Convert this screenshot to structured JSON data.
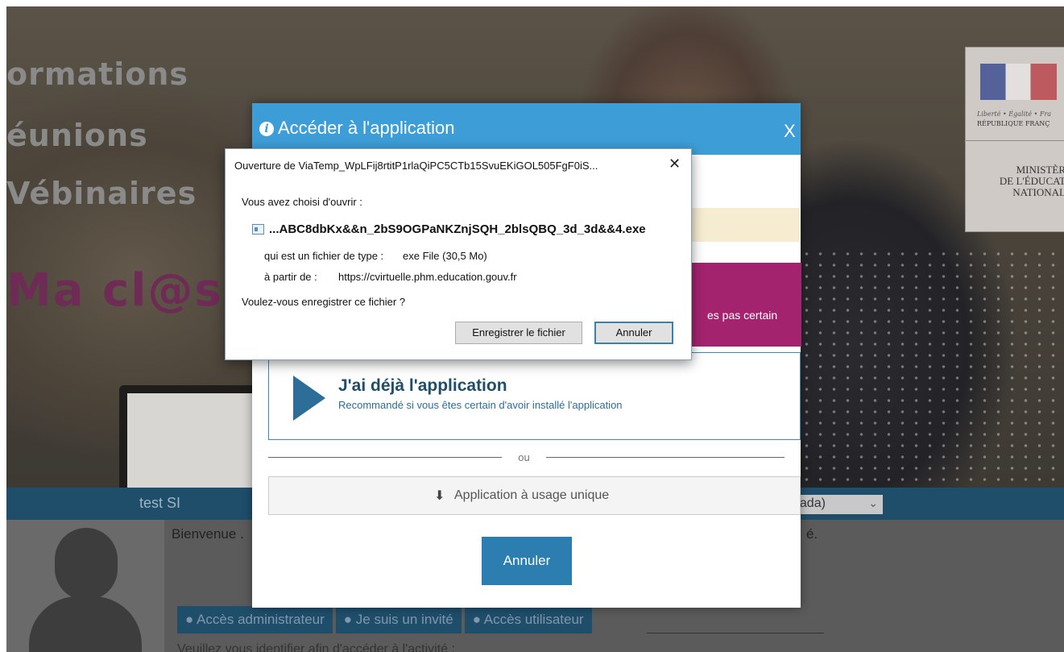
{
  "background": {
    "words": [
      "ormations",
      "éunions",
      "Vébinaires"
    ],
    "brand": "Ma cl@s",
    "logo": {
      "motto": "Liberté • Égalité • Fra",
      "republic": "RÉPUBLIQUE FRANÇ",
      "ministry": "MINISTÈR\nDE L'ÉDUCAT\nNATIONAL"
    },
    "bar": {
      "user": "test SI",
      "select_value": "nada)"
    },
    "welcome_left": "Bienvenue .",
    "welcome_right": "é.",
    "tabs": [
      "● Accès administrateur",
      "● Je suis un invité",
      "● Accès utilisateur"
    ],
    "instruction": "Veuillez vous identifier afin d'accéder à l'activité :"
  },
  "modal": {
    "title": "Accéder à l'application",
    "close_label": "X",
    "purple_text": "es pas certain",
    "already": {
      "title": "J'ai déjà l'application",
      "subtitle": "Recommandé si vous êtes certain d'avoir installé l'application"
    },
    "or_label": "ou",
    "single_use_label": "Application à usage unique",
    "cancel_label": "Annuler"
  },
  "download_dialog": {
    "title": "Ouverture de ViaTemp_WpLFij8rtitP1rlaQiPC5CTb15SvuEKiGOL505FgF0iS...",
    "close_label": "✕",
    "chose_text": "Vous avez choisi d'ouvrir :",
    "filename": "...ABC8dbKx&&n_2bS9OGPaNKZnjSQH_2blsQBQ_3d_3d&&4.exe",
    "type_label": "qui est un fichier de type :",
    "type_value": "exe File (30,5 Mo)",
    "from_label": "à partir de :",
    "from_value": "https://cvirtuelle.phm.education.gouv.fr",
    "question": "Voulez-vous enregistrer ce fichier ?",
    "save_label": "Enregistrer le fichier",
    "cancel_label": "Annuler"
  },
  "colors": {
    "modal_header": "#3d9ed7",
    "purple_card": "#a3236e",
    "primary_button": "#2c7db0",
    "bar": "#1f4e6b"
  }
}
